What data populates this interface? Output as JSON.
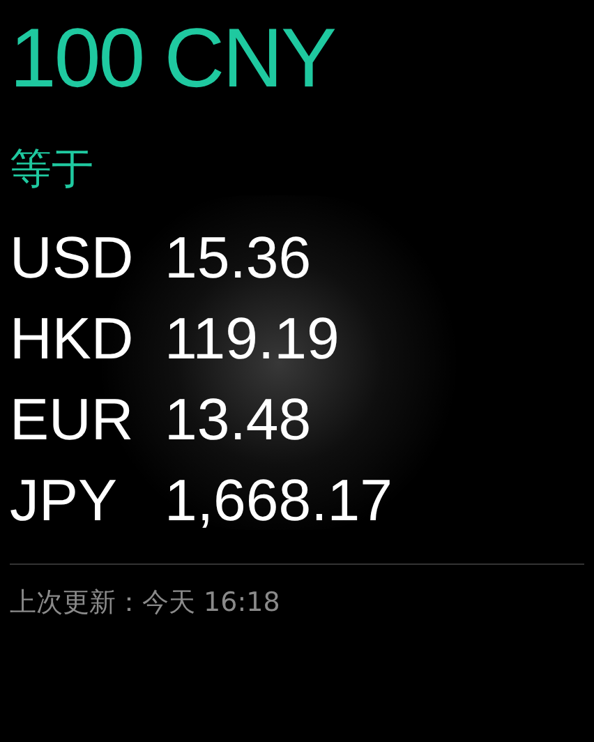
{
  "amount": "100 CNY",
  "equals_label": "等于",
  "rates": [
    {
      "code": "USD",
      "value": "15.36"
    },
    {
      "code": "HKD",
      "value": "119.19"
    },
    {
      "code": "EUR",
      "value": "13.48"
    },
    {
      "code": "JPY",
      "value": "1,668.17"
    }
  ],
  "last_updated": "上次更新：今天 16:18"
}
